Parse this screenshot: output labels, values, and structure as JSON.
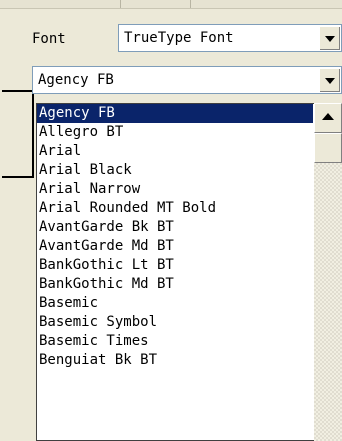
{
  "font_panel": {
    "label": "Font",
    "font_type_combo": {
      "value": "TrueType Font"
    },
    "font_name_combo": {
      "value": "Agency FB"
    }
  },
  "font_list": {
    "items": [
      "Agency FB",
      "Allegro BT",
      "Arial",
      "Arial Black",
      "Arial Narrow",
      "Arial Rounded MT Bold",
      "AvantGarde Bk BT",
      "AvantGarde Md BT",
      "BankGothic Lt BT",
      "BankGothic Md BT",
      "Basemic",
      "Basemic Symbol",
      "Basemic Times",
      "Benguiat Bk BT"
    ],
    "selected": "Agency FB"
  },
  "colors": {
    "background": "#ece9d8",
    "selection": "#0a246a",
    "selection_text": "#ffffff",
    "field_border": "#7f9db9"
  }
}
